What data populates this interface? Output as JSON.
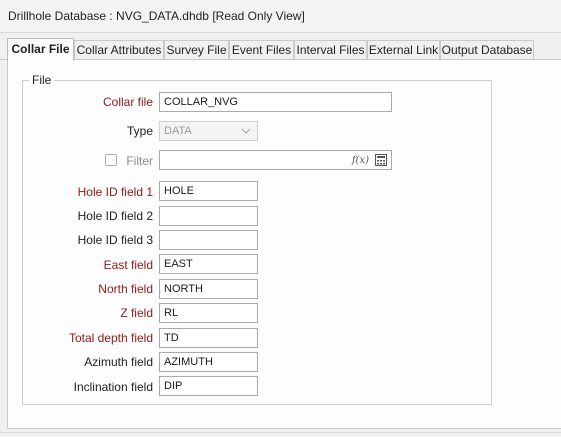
{
  "window": {
    "title": "Drillhole Database : NVG_DATA.dhdb [Read Only View]"
  },
  "tabs": [
    {
      "label": "Collar File",
      "active": true
    },
    {
      "label": "Collar Attributes",
      "active": false
    },
    {
      "label": "Survey File",
      "active": false
    },
    {
      "label": "Event Files",
      "active": false
    },
    {
      "label": "Interval Files",
      "active": false
    },
    {
      "label": "External Link",
      "active": false
    },
    {
      "label": "Output Database",
      "active": false
    }
  ],
  "group": {
    "label": "File"
  },
  "fields": {
    "collar_file": {
      "label": "Collar file",
      "value": "COLLAR_NVG"
    },
    "type": {
      "label": "Type",
      "value": "DATA"
    },
    "filter": {
      "label": "Filter",
      "value": "",
      "checked": false,
      "fx_label": "f(x)"
    },
    "hole_id_1": {
      "label": "Hole ID field 1",
      "value": "HOLE"
    },
    "hole_id_2": {
      "label": "Hole ID field 2",
      "value": ""
    },
    "hole_id_3": {
      "label": "Hole ID field 3",
      "value": ""
    },
    "east": {
      "label": "East field",
      "value": "EAST"
    },
    "north": {
      "label": "North field",
      "value": "NORTH"
    },
    "z": {
      "label": "Z field",
      "value": "RL"
    },
    "total_depth": {
      "label": "Total depth field",
      "value": "TD"
    },
    "azimuth": {
      "label": "Azimuth field",
      "value": "AZIMUTH"
    },
    "inclination": {
      "label": "Inclination field",
      "value": "DIP"
    }
  },
  "colors": {
    "required_label": "#8b1a1a",
    "border": "#a9a9a9",
    "panel": "#fdfdfd"
  }
}
